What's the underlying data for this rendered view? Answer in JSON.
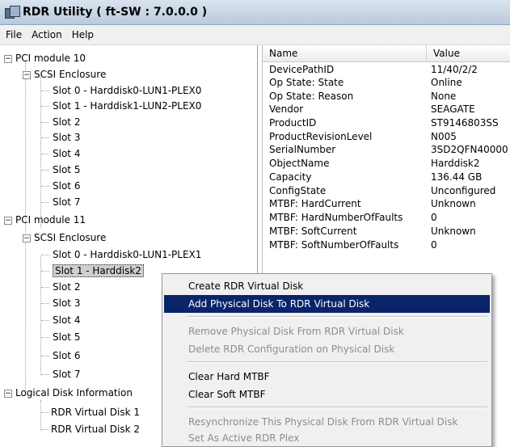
{
  "window": {
    "title": "RDR Utility  ( ft-SW : 7.0.0.0 )"
  },
  "menu": [
    "File",
    "Action",
    "Help"
  ],
  "tree": {
    "pci10": "PCI module 10",
    "pci10_enclosure": "SCSI Enclosure",
    "pci10_slots": [
      "Slot 0  -  Harddisk0-LUN1-PLEX0",
      "Slot 1  -  Harddisk1-LUN2-PLEX0",
      "Slot 2",
      "Slot 3",
      "Slot 4",
      "Slot 5",
      "Slot 6",
      "Slot 7"
    ],
    "pci11": "PCI module 11",
    "pci11_enclosure": "SCSI Enclosure",
    "pci11_slots": [
      "Slot 0  -  Harddisk0-LUN1-PLEX1",
      "Slot 1  -  Harddisk2",
      "Slot 2",
      "Slot 3",
      "Slot 4",
      "Slot 5",
      "Slot 6",
      "Slot 7"
    ],
    "logical": "Logical Disk Information",
    "logical_disks": [
      "RDR Virtual Disk 1",
      "RDR Virtual Disk 2"
    ]
  },
  "properties": {
    "col_name": "Name",
    "col_value": "Value",
    "rows": [
      {
        "name": "DevicePathID",
        "value": "11/40/2/2"
      },
      {
        "name": "Op State: State",
        "value": "Online"
      },
      {
        "name": "Op State: Reason",
        "value": "None"
      },
      {
        "name": "Vendor",
        "value": "SEAGATE"
      },
      {
        "name": "ProductID",
        "value": "ST9146803SS"
      },
      {
        "name": "ProductRevisionLevel",
        "value": "N005"
      },
      {
        "name": "SerialNumber",
        "value": "3SD2QFN40000"
      },
      {
        "name": "ObjectName",
        "value": "Harddisk2"
      },
      {
        "name": "Capacity",
        "value": "136.44 GB"
      },
      {
        "name": "ConfigState",
        "value": "Unconfigured"
      },
      {
        "name": "MTBF: HardCurrent",
        "value": "Unknown"
      },
      {
        "name": "MTBF: HardNumberOfFaults",
        "value": "0"
      },
      {
        "name": "MTBF: SoftCurrent",
        "value": "Unknown"
      },
      {
        "name": "MTBF: SoftNumberOfFaults",
        "value": "0"
      }
    ]
  },
  "context_menu": {
    "create": "Create RDR Virtual Disk",
    "add": "Add Physical Disk To RDR Virtual Disk",
    "remove": "Remove Physical Disk From RDR Virtual Disk",
    "delete_cfg": "Delete RDR Configuration on Physical Disk",
    "clear_hard": "Clear Hard MTBF",
    "clear_soft": "Clear Soft MTBF",
    "resync": "Resynchronize This Physical Disk From RDR Virtual Disk",
    "set_active": "Set As Active RDR Plex"
  },
  "colors": {
    "highlight": "#0a246a",
    "disabled_text": "#8d8d8d"
  }
}
